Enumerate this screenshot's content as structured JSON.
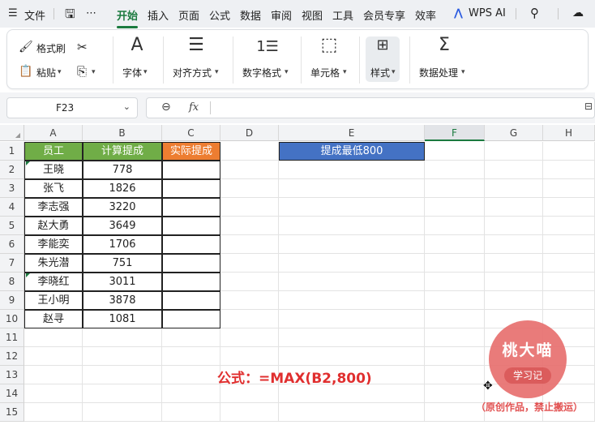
{
  "menubar": {
    "file": "文件",
    "more": "⋯",
    "tabs": [
      "开始",
      "插入",
      "页面",
      "公式",
      "数据",
      "审阅",
      "视图",
      "工具",
      "会员专享",
      "效率"
    ],
    "active_tab": "开始",
    "wps_ai": "WPS AI"
  },
  "ribbon": {
    "format_painter": "格式刷",
    "paste": "粘贴",
    "font": "字体",
    "align": "对齐方式",
    "number_format": "数字格式",
    "cell": "单元格",
    "style": "样式",
    "data_process": "数据处理"
  },
  "formula_bar": {
    "name_box": "F23",
    "fx": "fx",
    "formula": ""
  },
  "columns": [
    "A",
    "B",
    "C",
    "D",
    "E",
    "F",
    "G",
    "H"
  ],
  "selected_column": "F",
  "rows": [
    "1",
    "2",
    "3",
    "4",
    "5",
    "6",
    "7",
    "8",
    "9",
    "10",
    "11",
    "12",
    "13",
    "14",
    "15"
  ],
  "table": {
    "headers": [
      "员工",
      "计算提成",
      "实际提成"
    ],
    "employees": [
      {
        "name": "王晓",
        "amount": "778"
      },
      {
        "name": "张飞",
        "amount": "1826"
      },
      {
        "name": "李志强",
        "amount": "3220"
      },
      {
        "name": "赵大勇",
        "amount": "3649"
      },
      {
        "name": "李能奕",
        "amount": "1706"
      },
      {
        "name": "朱光潜",
        "amount": "751"
      },
      {
        "name": "李晓红",
        "amount": "3011"
      },
      {
        "name": "王小明",
        "amount": "3878"
      },
      {
        "name": "赵寻",
        "amount": "1081"
      }
    ]
  },
  "e1_label": "提成最低800",
  "formula_note": "公式：=MAX(B2,800)",
  "watermark": {
    "title": "桃大喵",
    "badge": "学习记",
    "note": "（原创作品，禁止搬运）"
  },
  "colors": {
    "accent_green": "#1b7a3f",
    "header_green": "#70ad47",
    "header_orange": "#ed7d31",
    "header_blue": "#4472c4",
    "note_red": "#e02f2f"
  }
}
